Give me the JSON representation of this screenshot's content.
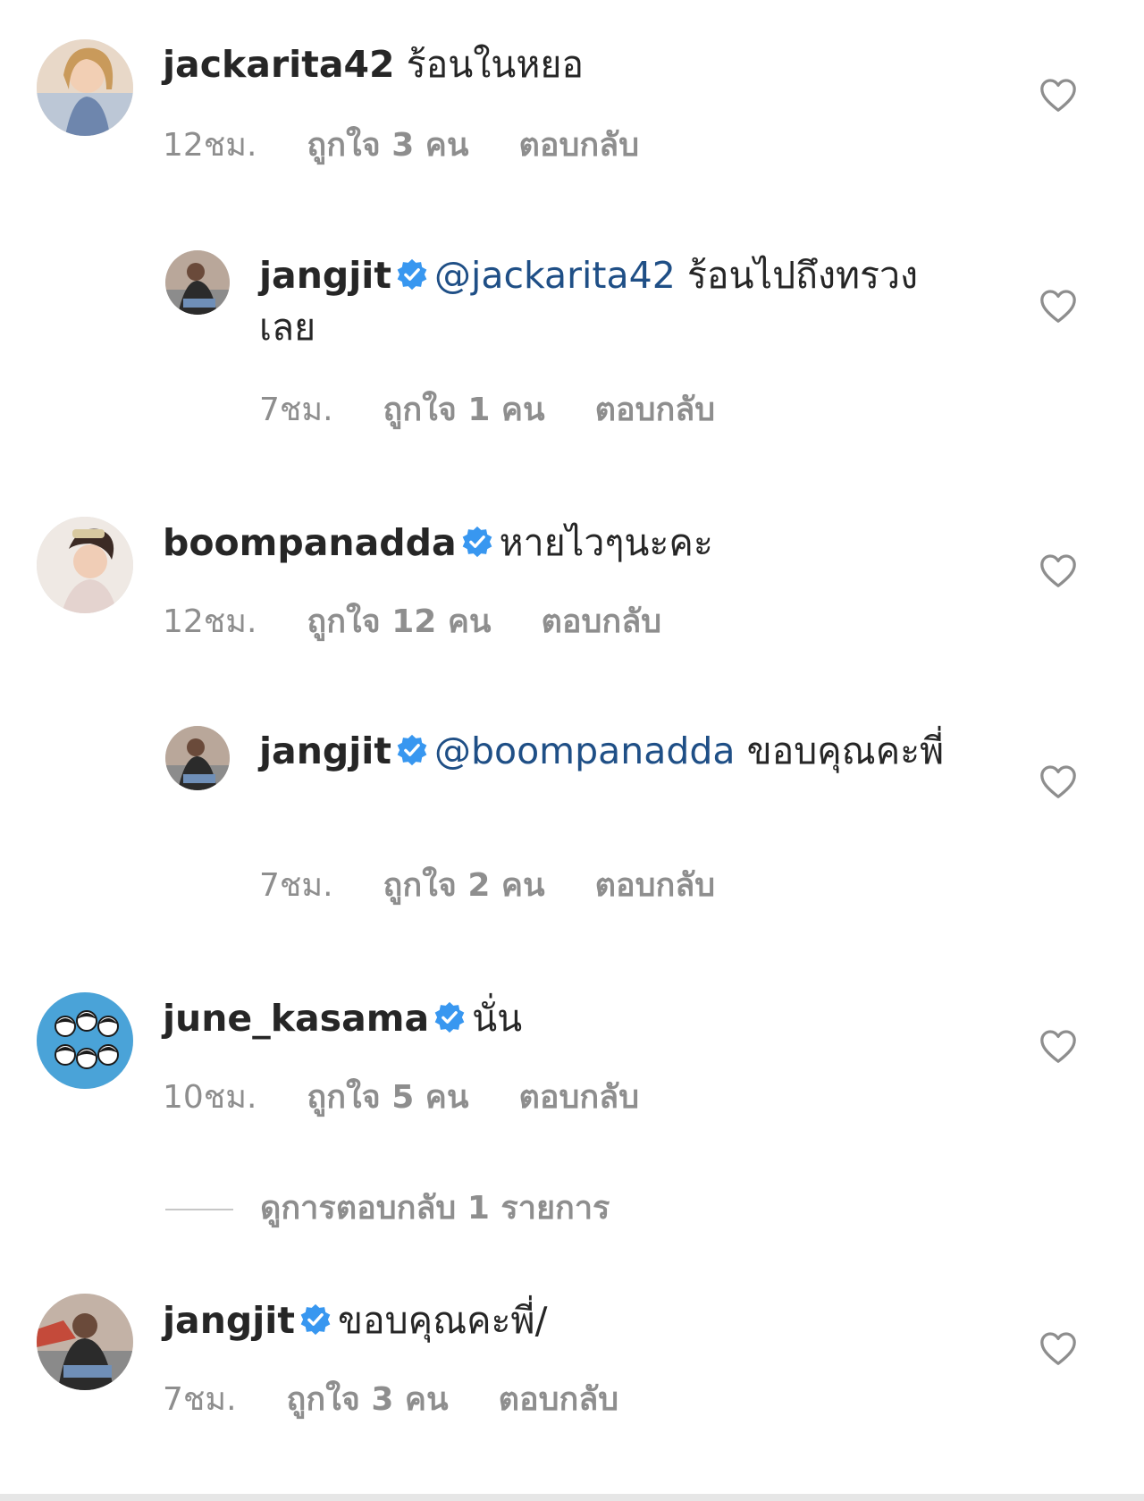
{
  "colors": {
    "text": "#262626",
    "meta": "#8e8e8e",
    "mention": "#1f4f86",
    "verified": "#3897f0"
  },
  "comments": [
    {
      "username": "jackarita42",
      "verified": false,
      "mention": "",
      "text": " ร้อนในหยอ",
      "time": "12ชม.",
      "likes": "ถูกใจ 3 คน",
      "reply": "ตอบกลับ"
    },
    {
      "username": "jangjit",
      "verified": true,
      "mention": "@jackarita42",
      "text": " ร้อนไปถึงทรวงเลย",
      "time": "7ชม.",
      "likes": "ถูกใจ 1 คน",
      "reply": "ตอบกลับ"
    },
    {
      "username": "boompanadda",
      "verified": true,
      "mention": "",
      "text": "หายไวๆนะคะ",
      "time": "12ชม.",
      "likes": "ถูกใจ 12 คน",
      "reply": "ตอบกลับ"
    },
    {
      "username": "jangjit",
      "verified": true,
      "mention": "@boompanadda",
      "text": " ขอบคุณคะพี่",
      "time": "7ชม.",
      "likes": "ถูกใจ 2 คน",
      "reply": "ตอบกลับ"
    },
    {
      "username": "june_kasama",
      "verified": true,
      "mention": "",
      "text": "นั่น",
      "time": "10ชม.",
      "likes": "ถูกใจ 5 คน",
      "reply": "ตอบกลับ"
    },
    {
      "username": "jangjit",
      "verified": true,
      "mention": "",
      "text": "ขอบคุณคะพี่/",
      "time": "7ชม.",
      "likes": "ถูกใจ 3 คน",
      "reply": "ตอบกลับ"
    }
  ],
  "view_replies": "ดูการตอบกลับ 1 รายการ",
  "icons": {
    "like": "heart-outline-icon",
    "verified": "verified-badge-icon"
  }
}
